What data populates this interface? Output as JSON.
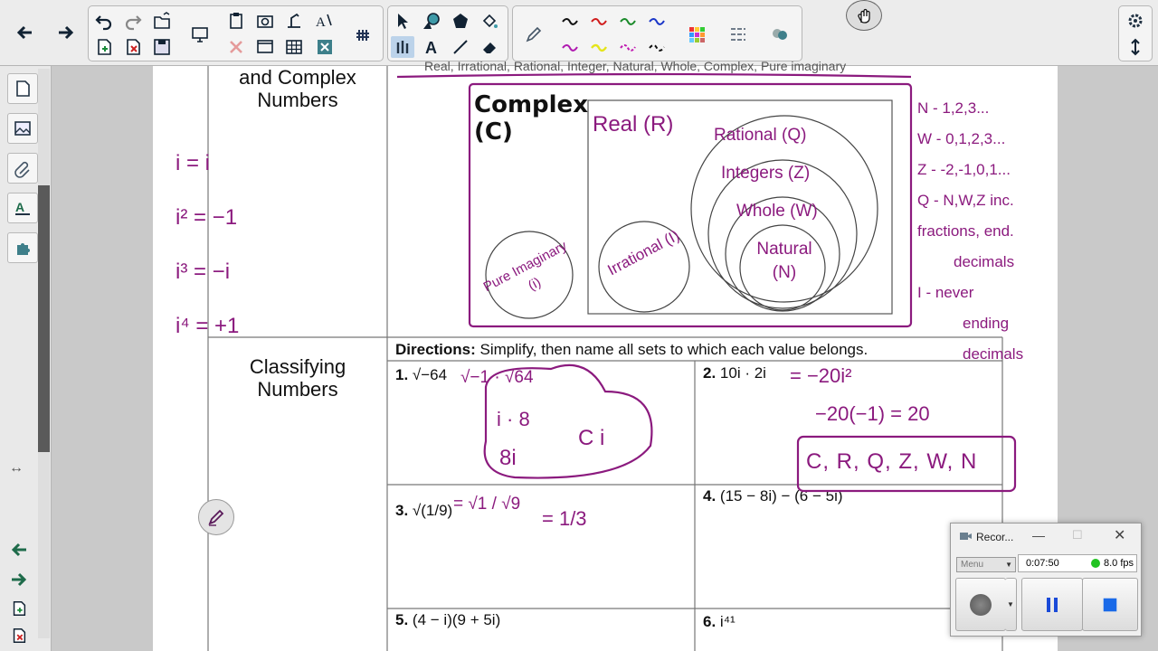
{
  "page": {
    "topic_complex": "and Complex Numbers",
    "topic_classifying": "Classifying Numbers",
    "header_cut_text": "Real, Irrational, Rational, Integer, Natural, Whole, Complex, Pure imaginary",
    "directions_label": "Directions:",
    "directions_text": "Simplify, then name all sets to which each value belongs.",
    "questions": [
      {
        "num": "1.",
        "expr": "√−64"
      },
      {
        "num": "2.",
        "expr": "10i · 2i"
      },
      {
        "num": "3.",
        "expr": "√(1/9)"
      },
      {
        "num": "4.",
        "expr": "(15 − 8i) − (6 − 5i)"
      },
      {
        "num": "5.",
        "expr": "(4 − i)(9 + 5i)"
      },
      {
        "num": "6.",
        "expr": "i⁴¹"
      }
    ]
  },
  "handwriting": {
    "powers": [
      "i = i",
      "i² = −1",
      "i³ = −i",
      "i⁴ = +1"
    ],
    "diagram": {
      "complex": "Complex (C)",
      "real": "Real (R)",
      "rational": "Rational (Q)",
      "integers": "Integers (Z)",
      "whole": "Whole (W)",
      "natural": "Natural (N)",
      "irrational": "Irrational (I)",
      "pure_imaginary": "Pure Imaginary (i)"
    },
    "notes": [
      "N - 1,2,3...",
      "W - 0,1,2,3...",
      "Z - -2,-1,0,1...",
      "Q - N,W,Z inc.",
      "fractions, end.",
      "decimals",
      "I - never",
      "ending",
      "decimals"
    ],
    "q1_work": [
      "√−1 · √64",
      "i · 8",
      "8i",
      "C i"
    ],
    "q2_work": [
      "= −20i²",
      "−20(−1) = 20",
      "C, R, Q, Z, W, N"
    ],
    "q3_work": [
      "= √1 / √9",
      "= 1/3"
    ]
  },
  "recorder": {
    "title": "Recor...",
    "menu": "Menu",
    "time": "0:07:50",
    "fps": "8.0 fps"
  },
  "colors": {
    "ink_purple": "#8b1a7e",
    "toolbar_bg": "#ececec",
    "nav_green": "#1e6b4a",
    "fps_green": "#22c322"
  }
}
